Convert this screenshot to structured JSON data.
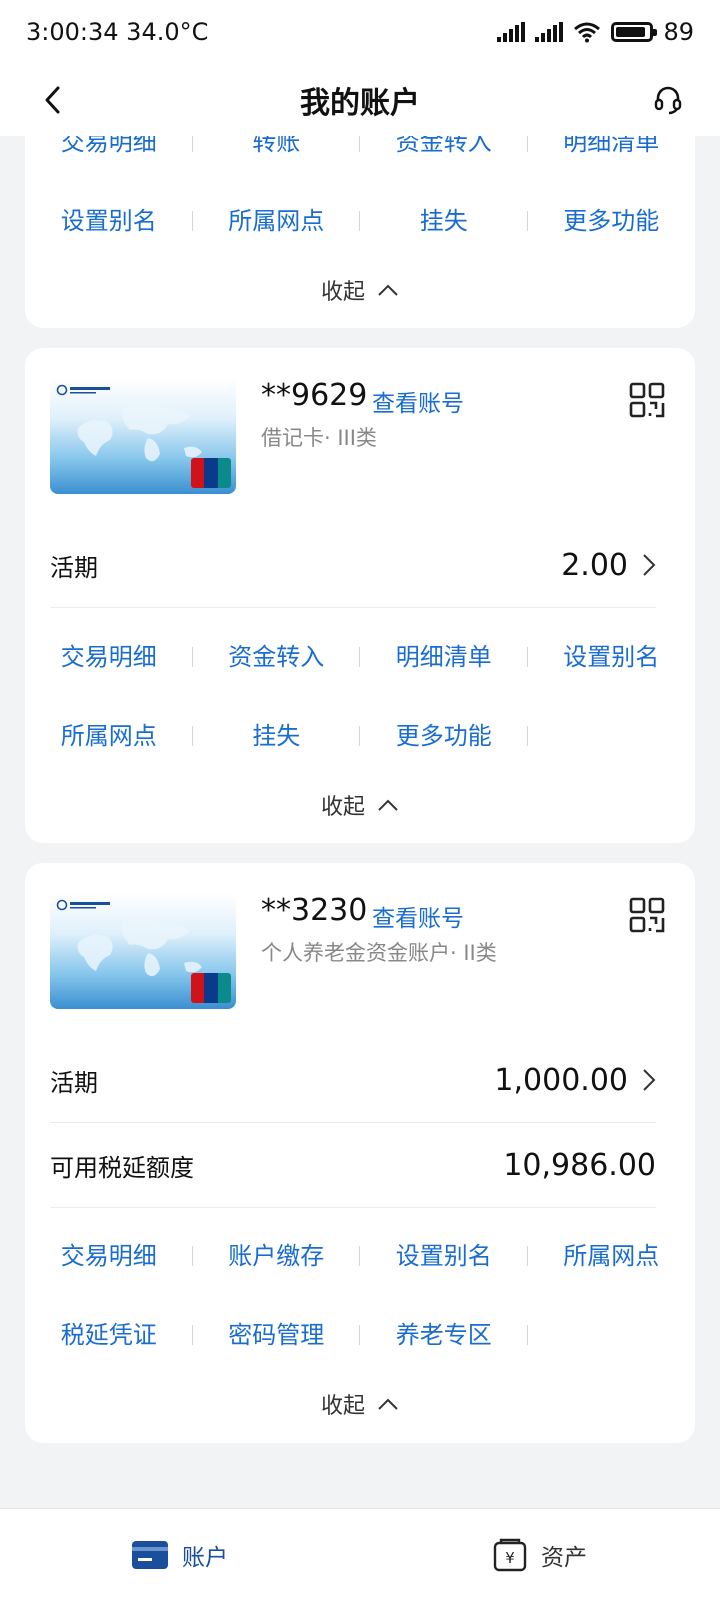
{
  "status_bar": {
    "time": "3:00:34",
    "temperature": "34.0°C",
    "battery": "89",
    "battery_level": 0.89
  },
  "nav": {
    "title": "我的账户",
    "back_icon": "chevron-left-icon",
    "service_icon": "headset-icon"
  },
  "cards": [
    {
      "actions": [
        [
          "交易明细",
          "转账",
          "资金转入",
          "明细清单"
        ],
        [
          "设置别名",
          "所属网点",
          "挂失",
          "更多功能"
        ]
      ],
      "collapse_label": "收起"
    },
    {
      "account_no": "**9629",
      "view_label": "查看账号",
      "account_type": "借记卡· III类",
      "balances": [
        {
          "label": "活期",
          "value": "2.00",
          "chevron": true
        }
      ],
      "actions": [
        [
          "交易明细",
          "资金转入",
          "明细清单",
          "设置别名"
        ],
        [
          "所属网点",
          "挂失",
          "更多功能"
        ]
      ],
      "collapse_label": "收起"
    },
    {
      "account_no": "**3230",
      "view_label": "查看账号",
      "account_type": "个人养老金资金账户· II类",
      "balances": [
        {
          "label": "活期",
          "value": "1,000.00",
          "chevron": true
        },
        {
          "label": "可用税延额度",
          "value": "10,986.00",
          "chevron": false
        }
      ],
      "actions": [
        [
          "交易明细",
          "账户缴存",
          "设置别名",
          "所属网点"
        ],
        [
          "税延凭证",
          "密码管理",
          "养老专区"
        ]
      ],
      "collapse_label": "收起"
    }
  ],
  "tab_bar": [
    {
      "label": "账户",
      "icon": "card-icon",
      "active": true
    },
    {
      "label": "资产",
      "icon": "yuan-icon",
      "active": false
    }
  ],
  "colors": {
    "accent": "#1a6dd0",
    "tab_active": "#1a4f9c",
    "background": "#f2f3f5"
  }
}
